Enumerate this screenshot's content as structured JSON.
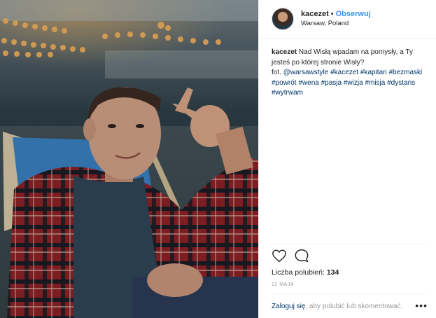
{
  "header": {
    "username": "kacezet",
    "separator": "•",
    "follow_label": "Obserwuj",
    "location": "Warsaw, Poland"
  },
  "caption": {
    "username": "kacezet",
    "text": "Nad Wisłą wpadam na pomysły, a Ty jesteś po której stronie Wisły?",
    "credit_prefix": "fot.",
    "credit": "@warsawstyle",
    "tags": [
      "#kacezet",
      "#kapitan",
      "#bezmaski",
      "#powrót",
      "#wena",
      "#pasja",
      "#wizja",
      "#misja",
      "#dystans",
      "#wytrwam"
    ]
  },
  "actions": {
    "like_icon": "heart-icon",
    "comment_icon": "comment-icon"
  },
  "likes": {
    "label": "Liczba polubień:",
    "count": "134"
  },
  "date": "12 MAJA",
  "footer": {
    "login_link": "Zaloguj się",
    "login_rest": ", aby polubić lub skomentować.",
    "more_label": "•••"
  },
  "colors": {
    "link_blue": "#3897f0",
    "hashtag": "#003569",
    "text": "#262626",
    "muted": "#999999"
  }
}
